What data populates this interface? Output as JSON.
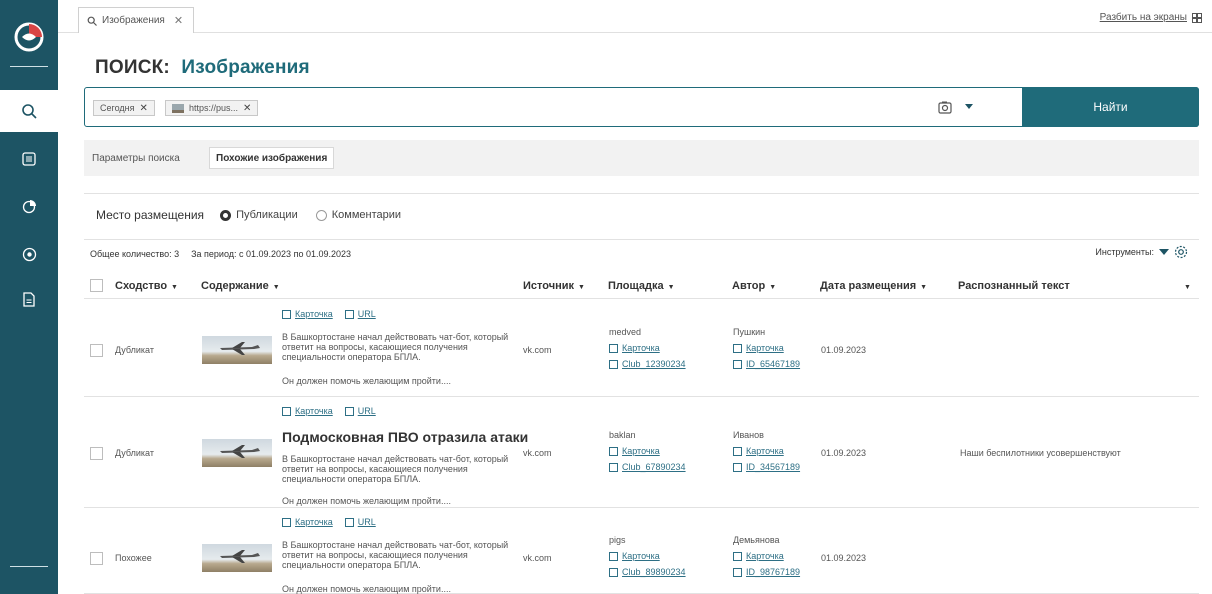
{
  "sidebar": {
    "items": [
      {
        "icon": "search-icon"
      },
      {
        "icon": "list-icon"
      },
      {
        "icon": "pie-chart-icon"
      },
      {
        "icon": "eye-icon"
      },
      {
        "icon": "document-icon"
      }
    ]
  },
  "tabs": {
    "active_label": "Изображения",
    "split_label": "Разбить на экраны"
  },
  "page": {
    "title_prefix": "ПОИСК:",
    "title_value": "Изображения"
  },
  "search": {
    "chips": [
      "Сегодня",
      "https://pus..."
    ],
    "find_label": "Найти"
  },
  "subtabs": [
    "Параметры поиска",
    "Похожие изображения"
  ],
  "placement": {
    "label": "Место размещения",
    "options": [
      "Публикации",
      "Комментарии"
    ],
    "selected": "Публикации"
  },
  "stats": {
    "total": "Общее количество: 3",
    "period": "За период: с 01.09.2023 по 01.09.2023",
    "tools_label": "Инструменты:"
  },
  "table": {
    "columns": [
      "Сходство",
      "Содержание",
      "Источник",
      "Площадка",
      "Автор",
      "Дата размещения",
      "Распознанный текст"
    ],
    "card_label": "Карточка",
    "url_label": "URL",
    "rows": [
      {
        "similarity": "Дубликат",
        "title": "",
        "text": "В Башкортостане начал действовать чат-бот, который ответит на вопросы, касающиеся получения специальности оператора БПЛА.",
        "more": "Он должен помочь желающим пройти....",
        "source": "vk.com",
        "platform_name": "medved",
        "platform_id": "Club_12390234",
        "author_name": "Пушкин",
        "author_id": "ID_65467189",
        "date": "01.09.2023",
        "recognized_text": ""
      },
      {
        "similarity": "Дубликат",
        "title": "Подмосковная ПВО отразила атаки",
        "text": "В Башкортостане начал действовать чат-бот, который ответит на вопросы, касающиеся получения специальности оператора БПЛА.",
        "more": "Он должен помочь желающим пройти....",
        "source": "vk.com",
        "platform_name": "baklan",
        "platform_id": "Club_67890234",
        "author_name": "Иванов",
        "author_id": "ID_34567189",
        "date": "01.09.2023",
        "recognized_text": "Наши беспилотники усовершенствуют"
      },
      {
        "similarity": "Похожее",
        "title": "",
        "text": "В Башкортостане начал действовать чат-бот, который ответит на вопросы, касающиеся получения специальности оператора БПЛА.",
        "more": "Он должен помочь желающим пройти....",
        "source": "vk.com",
        "platform_name": "pigs",
        "platform_id": "Club_89890234",
        "author_name": "Демьянова",
        "author_id": "ID_98767189",
        "date": "01.09.2023",
        "recognized_text": ""
      }
    ]
  },
  "colors": {
    "sidebar": "#1d5464",
    "accent": "#1f6b7a",
    "link": "#2d6f85"
  }
}
